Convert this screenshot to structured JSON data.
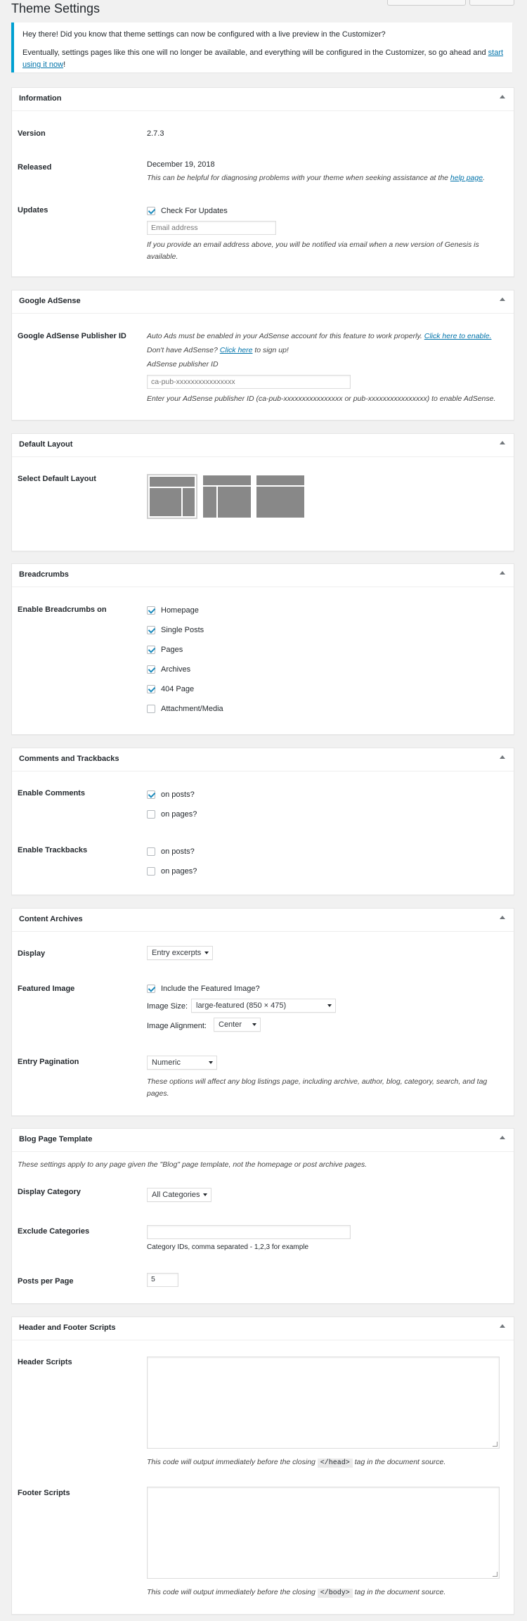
{
  "page": {
    "title": "Theme Settings"
  },
  "notice": {
    "line1": "Hey there! Did you know that theme settings can now be configured with a live preview in the Customizer?",
    "line2_prefix": "Eventually, settings pages like this one will no longer be available, and everything will be configured in the Customizer, so go ahead and ",
    "line2_link": "start using it now",
    "line2_suffix": "!"
  },
  "information": {
    "title": "Information",
    "version_label": "Version",
    "version_value": "2.7.3",
    "released_label": "Released",
    "released_value": "December 19, 2018",
    "released_desc_prefix": "This can be helpful for diagnosing problems with your theme when seeking assistance at the ",
    "released_desc_link": "help page",
    "released_desc_suffix": ".",
    "updates_label": "Updates",
    "check_updates_label": "Check For Updates",
    "email_placeholder": "Email address",
    "email_desc": "If you provide an email address above, you will be notified via email when a new version of Genesis is available."
  },
  "adsense": {
    "title": "Google AdSense",
    "publisher_label": "Google AdSense Publisher ID",
    "auto_ads_text": "Auto Ads must be enabled in your AdSense account for this feature to work properly. ",
    "auto_ads_link": "Click here to enable.",
    "no_adsense_text": "Don't have AdSense? ",
    "no_adsense_link": "Click here",
    "no_adsense_suffix": " to sign up!",
    "field_label": "AdSense publisher ID",
    "field_placeholder": "ca-pub-xxxxxxxxxxxxxxxx",
    "field_desc": "Enter your AdSense publisher ID (ca-pub-xxxxxxxxxxxxxxxx or pub-xxxxxxxxxxxxxxxx) to enable AdSense."
  },
  "default_layout": {
    "title": "Default Layout",
    "label": "Select Default Layout"
  },
  "breadcrumbs": {
    "title": "Breadcrumbs",
    "label": "Enable Breadcrumbs on",
    "items": [
      "Homepage",
      "Single Posts",
      "Pages",
      "Archives",
      "404 Page",
      "Attachment/Media"
    ],
    "checked": [
      true,
      true,
      true,
      true,
      true,
      false
    ]
  },
  "comments": {
    "title": "Comments and Trackbacks",
    "comments_label": "Enable Comments",
    "trackbacks_label": "Enable Trackbacks",
    "on_posts": "on posts?",
    "on_pages": "on pages?"
  },
  "archives": {
    "title": "Content Archives",
    "display_label": "Display",
    "display_value": "Entry excerpts",
    "featured_label": "Featured Image",
    "include_featured": "Include the Featured Image?",
    "image_size_label": "Image Size:",
    "image_size_value": "large-featured (850 × 475)",
    "image_align_label": "Image Alignment:",
    "image_align_value": "Center",
    "pagination_label": "Entry Pagination",
    "pagination_value": "Numeric",
    "pagination_desc": "These options will affect any blog listings page, including archive, author, blog, category, search, and tag pages."
  },
  "blog": {
    "title": "Blog Page Template",
    "intro": "These settings apply to any page given the \"Blog\" page template, not the homepage or post archive pages.",
    "category_label": "Display Category",
    "category_value": "All Categories",
    "exclude_label": "Exclude Categories",
    "exclude_desc": "Category IDs, comma separated - 1,2,3 for example",
    "ppp_label": "Posts per Page",
    "ppp_value": "5"
  },
  "scripts": {
    "title": "Header and Footer Scripts",
    "header_label": "Header Scripts",
    "header_desc_prefix": "This code will output immediately before the closing ",
    "header_code": "</head>",
    "header_desc_suffix": " tag in the document source.",
    "footer_label": "Footer Scripts",
    "footer_code": "</body>"
  },
  "colors": {
    "accent": "#00a0d2",
    "link": "#0073aa",
    "check": "#1e8cbe"
  }
}
